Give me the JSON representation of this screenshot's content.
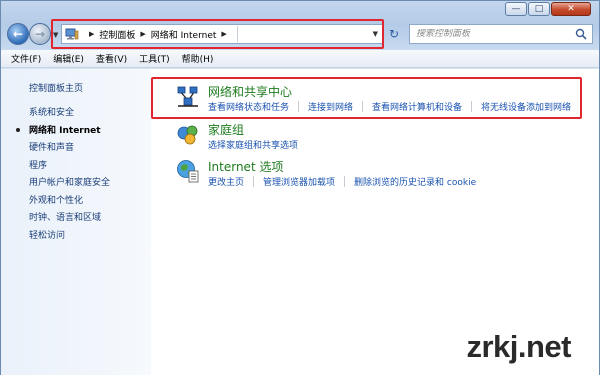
{
  "address": {
    "crumbs": [
      "控制面板",
      "网络和 Internet"
    ]
  },
  "search": {
    "placeholder": "搜索控制面板"
  },
  "menubar": [
    "文件(F)",
    "编辑(E)",
    "查看(V)",
    "工具(T)",
    "帮助(H)"
  ],
  "sidebar": {
    "home": "控制面板主页",
    "items": [
      {
        "label": "系统和安全",
        "active": false
      },
      {
        "label": "网络和 Internet",
        "active": true
      },
      {
        "label": "硬件和声音",
        "active": false
      },
      {
        "label": "程序",
        "active": false
      },
      {
        "label": "用户帐户和家庭安全",
        "active": false
      },
      {
        "label": "外观和个性化",
        "active": false
      },
      {
        "label": "时钟、语言和区域",
        "active": false
      },
      {
        "label": "轻松访问",
        "active": false
      }
    ]
  },
  "sections": [
    {
      "title": "网络和共享中心",
      "icon": "network-sharing-icon",
      "links": [
        "查看网络状态和任务",
        "连接到网络",
        "查看网络计算机和设备",
        "将无线设备添加到网络"
      ]
    },
    {
      "title": "家庭组",
      "icon": "homegroup-icon",
      "links": [
        "选择家庭组和共享选项"
      ]
    },
    {
      "title": "Internet 选项",
      "icon": "internet-options-icon",
      "links": [
        "更改主页",
        "管理浏览器加载项",
        "删除浏览的历史记录和 cookie"
      ]
    }
  ],
  "watermark": "zrkj.net",
  "colors": {
    "highlight": "#e0262f",
    "section_title": "#1e7b1e",
    "link": "#1a52b0",
    "sidebar_link": "#1a3e77"
  }
}
